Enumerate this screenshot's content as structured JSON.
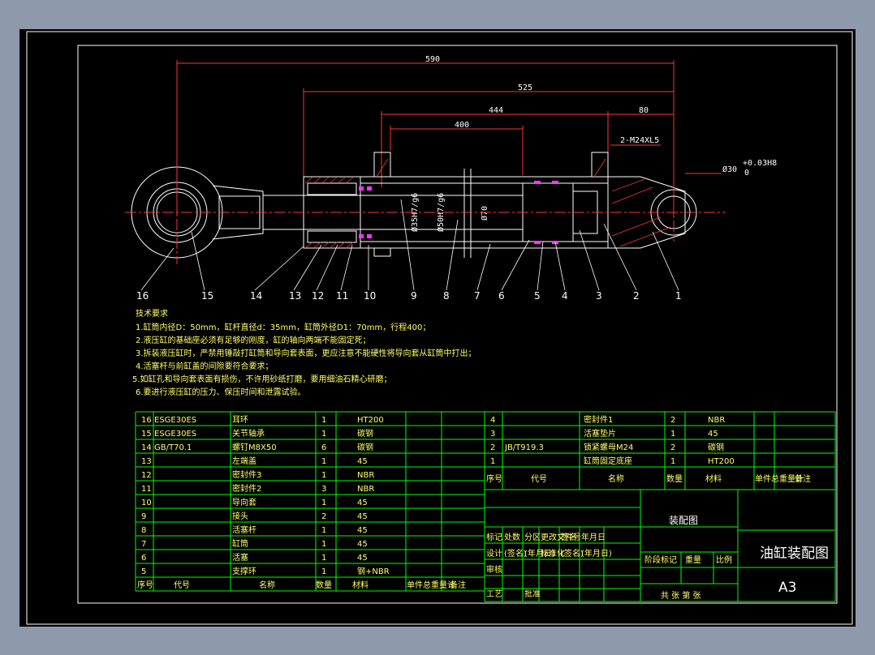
{
  "dimensions": {
    "d590": "590",
    "d525": "525",
    "d444": "444",
    "d400": "400",
    "d80": "80",
    "thread": "2-M24XL5",
    "bore": "Ø30",
    "tol_hi": "+0.03H8",
    "tol_lo": "0",
    "d_rod": "Ø35H7/g6",
    "d_bore": "Ø50H7/g6",
    "d_outer": "Ø70"
  },
  "balloons": [
    "16",
    "15",
    "14",
    "13",
    "12",
    "11",
    "10",
    "9",
    "8",
    "7",
    "6",
    "5",
    "4",
    "3",
    "2",
    "1"
  ],
  "tech": {
    "title": "技术要求",
    "lines": [
      "1.缸筒内径D：50mm，缸杆直径d：35mm，缸筒外径D1：70mm，行程400；",
      "2.液压缸的基础座必须有足够的刚度，缸的轴向两端不能固定死；",
      "3.拆装液压缸时，严禁用锤敲打缸筒和导向套表面，更应注意不能硬性将导向套从缸筒中打出；",
      "4.活塞杆与前缸盖的间隙要符合要求；",
      "5.如缸孔和导向套表面有损伤，不许用砂纸打磨，要用细油石精心研磨；",
      "6.要进行液压缸的压力、保压时间和泄露试验。"
    ]
  },
  "bom_left": [
    {
      "no": "16",
      "code": "ESGE30ES",
      "name": "耳环",
      "qty": "1",
      "mat": "HT200"
    },
    {
      "no": "15",
      "code": "ESGE30ES",
      "name": "关节轴承",
      "qty": "1",
      "mat": "碳钢"
    },
    {
      "no": "14",
      "code": "GB/T70.1",
      "name": "螺钉M8X50",
      "qty": "6",
      "mat": "碳钢"
    },
    {
      "no": "13",
      "code": "",
      "name": "左端盖",
      "qty": "1",
      "mat": "45"
    },
    {
      "no": "12",
      "code": "",
      "name": "密封件3",
      "qty": "1",
      "mat": "NBR"
    },
    {
      "no": "11",
      "code": "",
      "name": "密封件2",
      "qty": "3",
      "mat": "NBR"
    },
    {
      "no": "10",
      "code": "",
      "name": "导向套",
      "qty": "1",
      "mat": "45"
    },
    {
      "no": "9",
      "code": "",
      "name": "接头",
      "qty": "2",
      "mat": "45"
    },
    {
      "no": "8",
      "code": "",
      "name": "活塞杆",
      "qty": "1",
      "mat": "45"
    },
    {
      "no": "7",
      "code": "",
      "name": "缸筒",
      "qty": "1",
      "mat": "45"
    },
    {
      "no": "6",
      "code": "",
      "name": "活塞",
      "qty": "1",
      "mat": "45"
    },
    {
      "no": "5",
      "code": "",
      "name": "支撑环",
      "qty": "1",
      "mat": "钢+NBR"
    }
  ],
  "bom_left_header": {
    "no": "序号",
    "code": "代号",
    "name": "名称",
    "qty": "数量",
    "mat": "材料",
    "wt": "单件总重量计",
    "note": "备注"
  },
  "bom_right": [
    {
      "no": "4",
      "code": "",
      "name": "密封件1",
      "qty": "2",
      "mat": "NBR"
    },
    {
      "no": "3",
      "code": "",
      "name": "活塞垫片",
      "qty": "1",
      "mat": "45"
    },
    {
      "no": "2",
      "code": "JB/T919.3",
      "name": "锁紧螺母M24",
      "qty": "2",
      "mat": "碳钢"
    },
    {
      "no": "1",
      "code": "",
      "name": "缸筒固定底座",
      "qty": "1",
      "mat": "HT200"
    }
  ],
  "bom_right_header": {
    "no": "序号",
    "code": "代号",
    "name": "名称",
    "qty": "数量",
    "mat": "材料",
    "wt": "单件总重量计",
    "note": "备注"
  },
  "title_block": {
    "drawing": "装配图",
    "title": "油缸装配图",
    "size": "A3",
    "r1": [
      "标记",
      "处数",
      "分区",
      "更改文件号",
      "签名",
      "年月日"
    ],
    "r2": [
      "设计",
      "(签名)",
      "(年月日)",
      "标准化",
      "(签名)",
      "(年月日)"
    ],
    "r3": [
      "审核"
    ],
    "r4": [
      "工艺",
      "",
      "批准"
    ],
    "stage": "阶段标记",
    "weight": "重量",
    "scale": "比例",
    "sheets": "共  张  第  张"
  },
  "colors": {
    "frame": "#00ff00",
    "line": "#ffffff",
    "center": "#ff3333",
    "dim": "#ff3333",
    "seal": "#ff33ff",
    "text": "#ffff66",
    "sheet": "#000000"
  }
}
